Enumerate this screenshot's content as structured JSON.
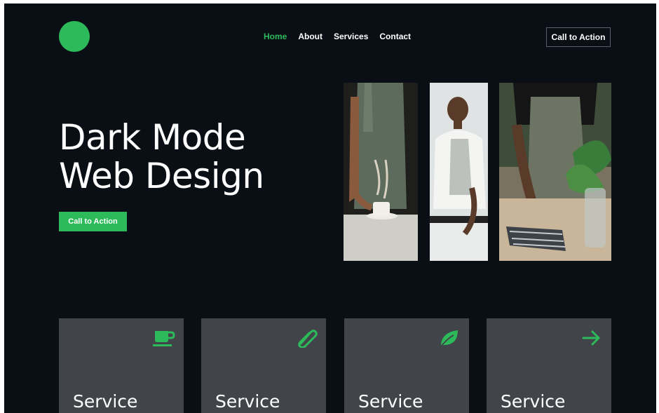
{
  "header": {
    "nav": [
      {
        "label": "Home",
        "active": true
      },
      {
        "label": "About",
        "active": false
      },
      {
        "label": "Services",
        "active": false
      },
      {
        "label": "Contact",
        "active": false
      }
    ],
    "cta_label": "Call to Action"
  },
  "hero": {
    "title_line1": "Dark Mode",
    "title_line2": "Web Design",
    "cta_label": "Call to Action"
  },
  "services": [
    {
      "label": "Service",
      "icon": "coffee-cup-icon"
    },
    {
      "label": "Service",
      "icon": "paperclip-icon"
    },
    {
      "label": "Service",
      "icon": "leaf-icon"
    },
    {
      "label": "Service",
      "icon": "arrow-right-icon"
    }
  ],
  "colors": {
    "background": "#0a0f16",
    "accent": "#2dba5a",
    "card": "#414549",
    "text": "#ffffff"
  }
}
